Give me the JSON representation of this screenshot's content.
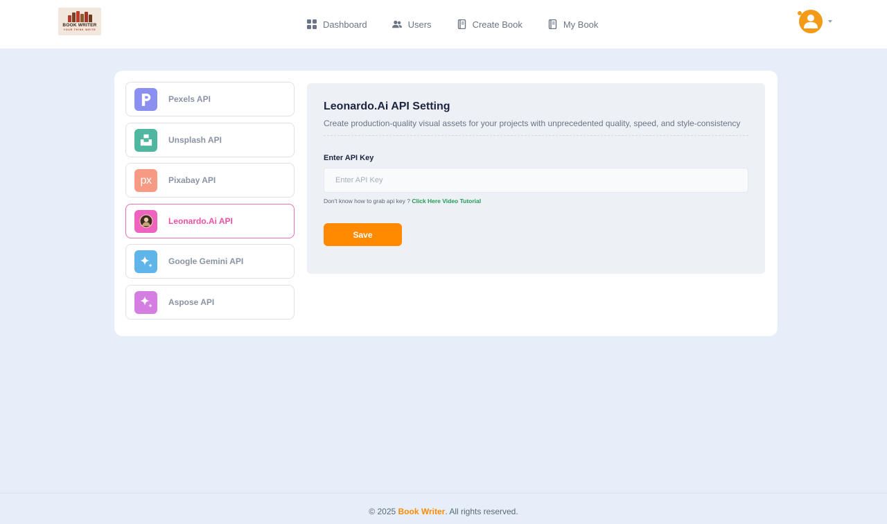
{
  "logo": {
    "title": "BOOK WRITER",
    "tagline": "YOUR THINK WRITE"
  },
  "nav": {
    "items": [
      {
        "label": "Dashboard",
        "icon": "dashboard-grid-icon"
      },
      {
        "label": "Users",
        "icon": "users-icon"
      },
      {
        "label": "Create Book",
        "icon": "book-icon"
      },
      {
        "label": "My Book",
        "icon": "book-icon"
      }
    ]
  },
  "colors": {
    "accent": "#ff8a00",
    "active_pink": "#ef4fa6",
    "link_green": "#1f9d55",
    "page_bg": "#e6eef9"
  },
  "sidebar": {
    "items": [
      {
        "label": "Pexels API",
        "icon": "pexels-icon",
        "color": "#8b8ff0"
      },
      {
        "label": "Unsplash API",
        "icon": "unsplash-icon",
        "color": "#4fb7a0"
      },
      {
        "label": "Pixabay API",
        "icon": "pixabay-icon",
        "icon_text": "px",
        "color": "#f79a83"
      },
      {
        "label": "Leonardo.Ai API",
        "icon": "leonardo-icon",
        "color": "#ee62c0",
        "active": true
      },
      {
        "label": "Google Gemini API",
        "icon": "sparkle-icon",
        "color": "#5fb4ea"
      },
      {
        "label": "Aspose API",
        "icon": "sparkle-icon",
        "color": "#d57ee2"
      }
    ]
  },
  "settings": {
    "title": "Leonardo.Ai API Setting",
    "subtitle": "Create production-quality visual assets for your projects with unprecedented quality, speed, and style-consistency",
    "field_label": "Enter API Key",
    "input_placeholder": "Enter API Key",
    "input_value": "",
    "help_text": "Don't know how to grab api key ? ",
    "help_link": "Click Here Video Tutorial",
    "save_label": "Save"
  },
  "footer": {
    "prefix": "© 2025 ",
    "brand": "Book Writer",
    "suffix": ". All rights reserved."
  }
}
